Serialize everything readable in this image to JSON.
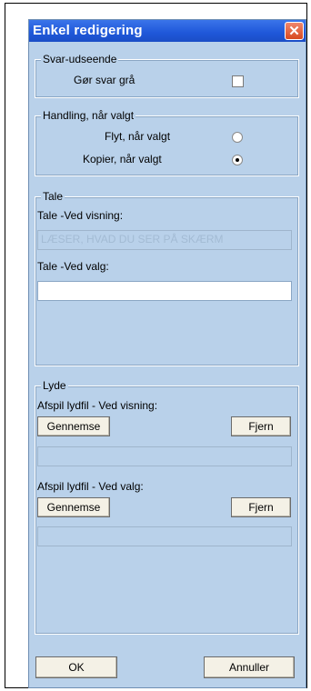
{
  "window": {
    "title": "Enkel redigering",
    "close_glyph": "✕"
  },
  "svar": {
    "legend": "Svar-udseende",
    "gray_label": "Gør svar grå",
    "gray_checked": false
  },
  "handling": {
    "legend": "Handling, når valgt",
    "move_label": "Flyt, når valgt",
    "copy_label": "Kopier, når valgt",
    "selected": "copy"
  },
  "tale": {
    "legend": "Tale",
    "view_label": "Tale -Ved visning:",
    "view_value": "LÆSER, HVAD DU SER PÅ SKÆRM",
    "select_label": "Tale -Ved valg:",
    "select_value": ""
  },
  "lyde": {
    "legend": "Lyde",
    "view_label": "Afspil lydfil - Ved visning:",
    "select_label": "Afspil lydfil - Ved valg:",
    "browse_label": "Gennemse",
    "remove_label": "Fjern",
    "view_file": "",
    "select_file": ""
  },
  "footer": {
    "ok_label": "OK",
    "cancel_label": "Annuller"
  }
}
